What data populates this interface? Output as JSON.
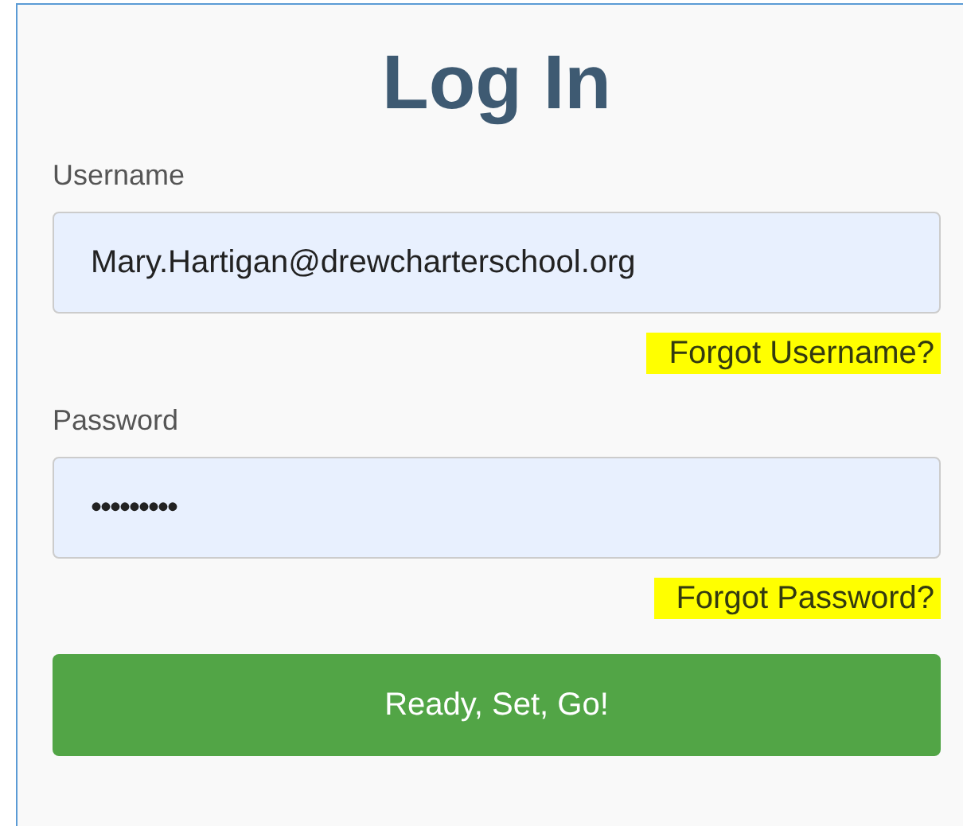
{
  "title": "Log In",
  "fields": [
    {
      "label": "Username",
      "value": "Mary.Hartigan@drewcharterschool.org",
      "kind": "text",
      "link": {
        "label": "Forgot Username?",
        "highlighted": true
      }
    },
    {
      "label": "Password",
      "value": "•••••••••",
      "kind": "password",
      "link": {
        "label": "Forgot Password?",
        "highlighted": true
      }
    }
  ],
  "submit_button": "Ready, Set, Go!"
}
